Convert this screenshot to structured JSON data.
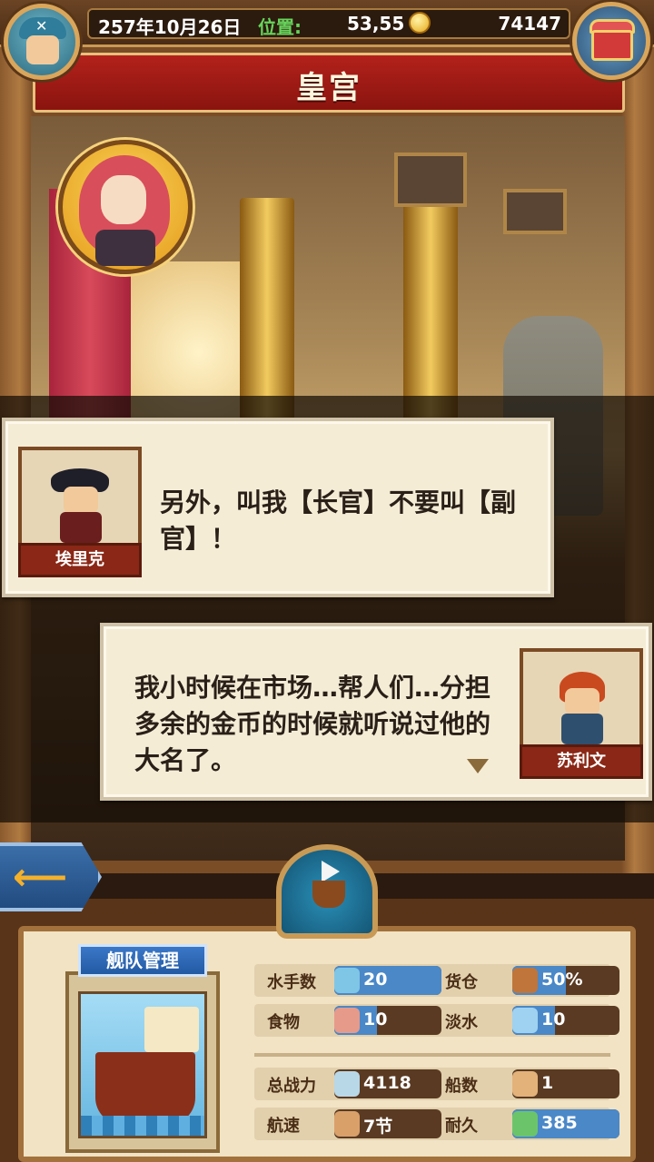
{
  "hud": {
    "date": "257年10月26日",
    "location_label": "位置:",
    "location": "53,55",
    "gold": "74147"
  },
  "location_title": "皇宫",
  "dialogs": [
    {
      "speaker": "埃里克",
      "text": "另外，叫我【长官】不要叫【副官】！"
    },
    {
      "speaker": "苏利文",
      "text": "我小时候在市场…帮人们…分担多余的金币的时候就听说过他的大名了。"
    }
  ],
  "fleet": {
    "tag": "舰队管理",
    "stats": [
      {
        "label": "水手数",
        "value": "20",
        "icon": "sailor-icon",
        "fill": 1.0
      },
      {
        "label": "货仓",
        "value": "50%",
        "icon": "cargo-icon",
        "fill": 0.5
      },
      {
        "label": "食物",
        "value": "10",
        "icon": "food-icon",
        "fill": 0.4
      },
      {
        "label": "淡水",
        "value": "10",
        "icon": "water-icon",
        "fill": 0.4
      },
      {
        "label": "总战力",
        "value": "4118",
        "icon": "power-icon",
        "fill": 0
      },
      {
        "label": "船数",
        "value": "1",
        "icon": "ship-count-icon",
        "fill": 0
      },
      {
        "label": "航速",
        "value": "7节",
        "icon": "speed-icon",
        "fill": 0
      },
      {
        "label": "耐久",
        "value": "385",
        "icon": "durability-icon",
        "fill": 1.0
      }
    ]
  },
  "colors": {
    "accent_green": "#67d45b",
    "title_red": "#b3211b",
    "name_plate": "#8a2716",
    "stat_blue": "#4a88c8"
  }
}
